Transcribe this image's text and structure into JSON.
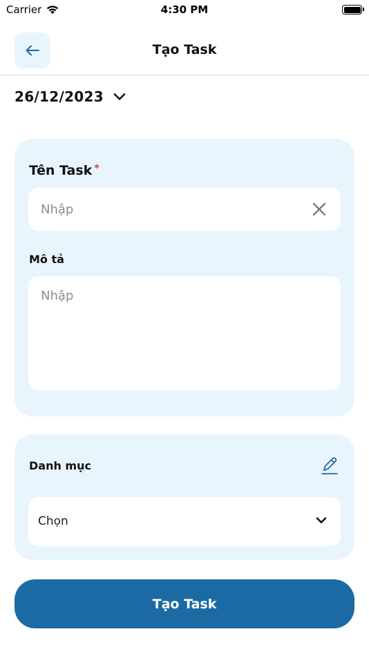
{
  "status_bar": {
    "carrier": "Carrier",
    "time": "4:30 PM"
  },
  "header": {
    "title": "Tạo Task",
    "back_icon": "arrow-left-icon"
  },
  "date_picker": {
    "value": "26/12/2023",
    "icon": "chevron-down-icon"
  },
  "task_form": {
    "name_label": "Tên Task",
    "required_mark": "*",
    "name_placeholder": "Nhập",
    "name_value": "",
    "description_label": "Mô tả",
    "description_placeholder": "Nhập",
    "description_value": ""
  },
  "category": {
    "label": "Danh mục",
    "select_value": "Chọn",
    "edit_icon": "pencil-icon"
  },
  "submit": {
    "label": "Tạo Task"
  },
  "colors": {
    "accent": "#1c6aa3",
    "card_background": "#e9f5fc",
    "required": "#e53935"
  }
}
